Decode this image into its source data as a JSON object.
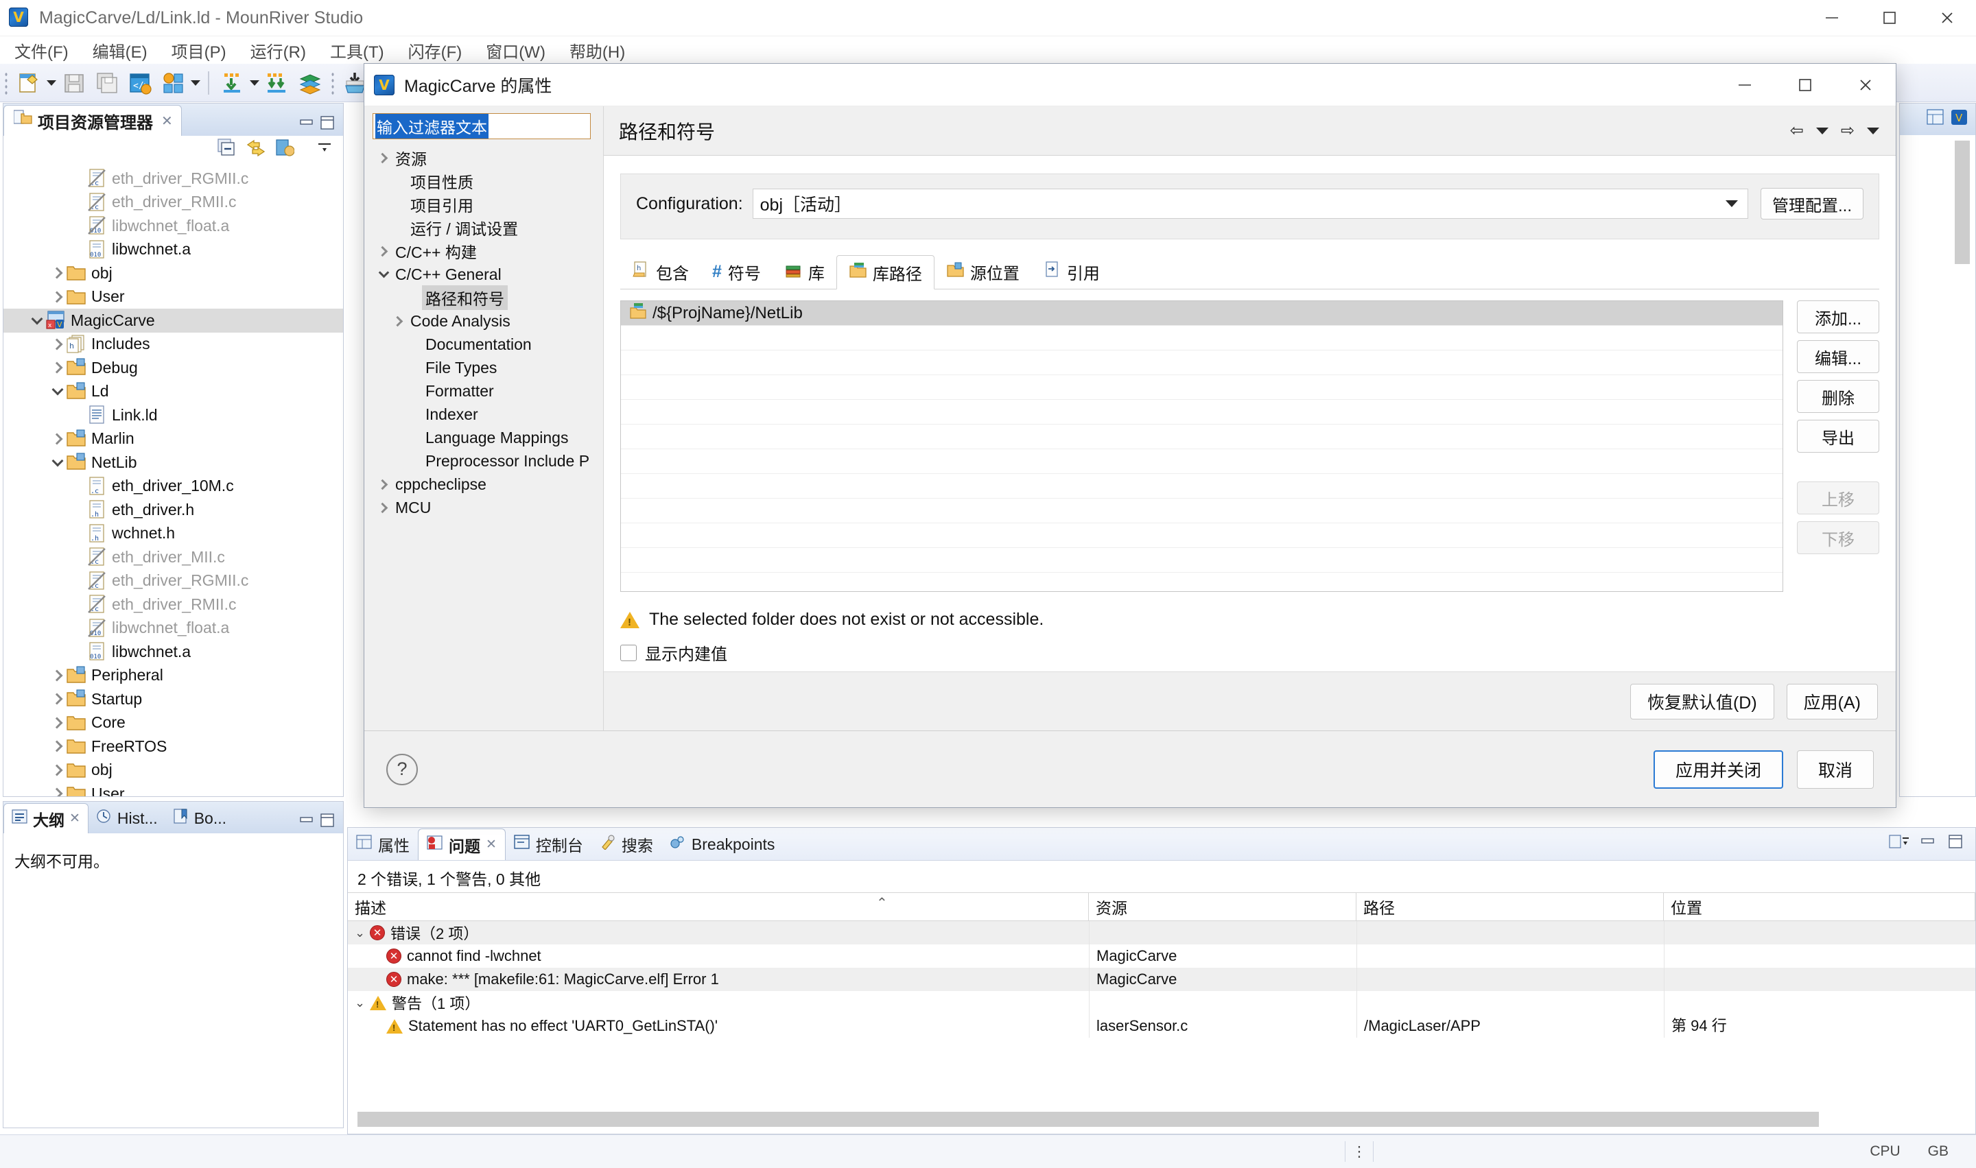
{
  "window": {
    "title": "MagicCarve/Ld/Link.ld - MounRiver Studio",
    "app_icon": "mounriver-logo-icon",
    "controls": {
      "minimize": "minimize-icon",
      "maximize": "maximize-icon",
      "close": "close-icon"
    }
  },
  "menu": {
    "items": [
      "文件(F)",
      "编辑(E)",
      "项目(P)",
      "运行(R)",
      "工具(T)",
      "闪存(F)",
      "窗口(W)",
      "帮助(H)"
    ]
  },
  "toolbar": {
    "items": [
      {
        "name": "new-icon",
        "arrow": true
      },
      {
        "name": "save-icon",
        "arrow": false
      },
      {
        "name": "save-all-icon",
        "arrow": false
      },
      {
        "name": "build-configure-icon",
        "arrow": false
      },
      {
        "name": "build-project-icon",
        "arrow": true
      },
      {
        "name": "download-icon",
        "arrow": true
      },
      {
        "name": "download-all-icon",
        "arrow": false
      },
      {
        "name": "library-icon",
        "arrow": false
      },
      {
        "name": "flash-download-icon",
        "arrow": true
      },
      {
        "name": "export-icon",
        "arrow": false
      }
    ]
  },
  "explorer": {
    "tab_label": "项目资源管理器",
    "close_icon": "close-icon",
    "tools": [
      "collapse-all-icon",
      "link-with-editor-icon",
      "view-menu-icon"
    ],
    "panel_buttons": [
      "minimize-icon",
      "maximize-icon"
    ],
    "tree": [
      {
        "label": "eth_driver_RGMII.c",
        "indent": 3,
        "twisty": "",
        "icon": "c-file-excluded-icon",
        "dim": true,
        "selected": false
      },
      {
        "label": "eth_driver_RMII.c",
        "indent": 3,
        "twisty": "",
        "icon": "c-file-excluded-icon",
        "dim": true,
        "selected": false
      },
      {
        "label": "libwchnet_float.a",
        "indent": 3,
        "twisty": "",
        "icon": "archive-excluded-icon",
        "dim": true,
        "selected": false
      },
      {
        "label": "libwchnet.a",
        "indent": 3,
        "twisty": "",
        "icon": "archive-icon",
        "dim": false,
        "selected": false
      },
      {
        "label": "obj",
        "indent": 2,
        "twisty": "right",
        "icon": "folder-icon",
        "dim": false,
        "selected": false
      },
      {
        "label": "User",
        "indent": 2,
        "twisty": "right",
        "icon": "folder-icon",
        "dim": false,
        "selected": false
      },
      {
        "label": "MagicCarve",
        "indent": 1,
        "twisty": "down",
        "icon": "project-icon",
        "dim": false,
        "selected": true
      },
      {
        "label": "Includes",
        "indent": 2,
        "twisty": "right",
        "icon": "includes-icon",
        "dim": false,
        "selected": false
      },
      {
        "label": "Debug",
        "indent": 2,
        "twisty": "right",
        "icon": "source-folder-icon",
        "dim": false,
        "selected": false
      },
      {
        "label": "Ld",
        "indent": 2,
        "twisty": "down",
        "icon": "source-folder-icon",
        "dim": false,
        "selected": false
      },
      {
        "label": "Link.ld",
        "indent": 3,
        "twisty": "",
        "icon": "text-file-icon",
        "dim": false,
        "selected": false
      },
      {
        "label": "Marlin",
        "indent": 2,
        "twisty": "right",
        "icon": "source-folder-icon",
        "dim": false,
        "selected": false
      },
      {
        "label": "NetLib",
        "indent": 2,
        "twisty": "down",
        "icon": "source-folder-icon",
        "dim": false,
        "selected": false
      },
      {
        "label": "eth_driver_10M.c",
        "indent": 3,
        "twisty": "",
        "icon": "c-file-icon",
        "dim": false,
        "selected": false
      },
      {
        "label": "eth_driver.h",
        "indent": 3,
        "twisty": "",
        "icon": "h-file-icon",
        "dim": false,
        "selected": false
      },
      {
        "label": "wchnet.h",
        "indent": 3,
        "twisty": "",
        "icon": "h-file-icon",
        "dim": false,
        "selected": false
      },
      {
        "label": "eth_driver_MII.c",
        "indent": 3,
        "twisty": "",
        "icon": "c-file-excluded-icon",
        "dim": true,
        "selected": false
      },
      {
        "label": "eth_driver_RGMII.c",
        "indent": 3,
        "twisty": "",
        "icon": "c-file-excluded-icon",
        "dim": true,
        "selected": false
      },
      {
        "label": "eth_driver_RMII.c",
        "indent": 3,
        "twisty": "",
        "icon": "c-file-excluded-icon",
        "dim": true,
        "selected": false
      },
      {
        "label": "libwchnet_float.a",
        "indent": 3,
        "twisty": "",
        "icon": "archive-excluded-icon",
        "dim": true,
        "selected": false
      },
      {
        "label": "libwchnet.a",
        "indent": 3,
        "twisty": "",
        "icon": "archive-icon",
        "dim": false,
        "selected": false
      },
      {
        "label": "Peripheral",
        "indent": 2,
        "twisty": "right",
        "icon": "source-folder-icon",
        "dim": false,
        "selected": false
      },
      {
        "label": "Startup",
        "indent": 2,
        "twisty": "right",
        "icon": "source-folder-icon",
        "dim": false,
        "selected": false
      },
      {
        "label": "Core",
        "indent": 2,
        "twisty": "right",
        "icon": "folder-icon",
        "dim": false,
        "selected": false
      },
      {
        "label": "FreeRTOS",
        "indent": 2,
        "twisty": "right",
        "icon": "folder-icon",
        "dim": false,
        "selected": false
      },
      {
        "label": "obj",
        "indent": 2,
        "twisty": "right",
        "icon": "folder-icon",
        "dim": false,
        "selected": false
      },
      {
        "label": "User",
        "indent": 2,
        "twisty": "right",
        "icon": "folder-icon",
        "dim": false,
        "selected": false
      }
    ]
  },
  "outline": {
    "tabs": [
      {
        "label": "大纲",
        "active": true,
        "icon": "outline-icon",
        "close_icon": "close-icon"
      },
      {
        "label": "Hist...",
        "active": false,
        "icon": "history-icon"
      },
      {
        "label": "Bo...",
        "active": false,
        "icon": "bookmarks-icon"
      }
    ],
    "body_text": "大纲不可用。",
    "panel_buttons": [
      "minimize-icon",
      "maximize-icon"
    ]
  },
  "dialog": {
    "title": "MagicCarve 的属性",
    "icon": "mounriver-logo-icon",
    "controls": {
      "minimize": "minimize-icon",
      "maximize": "maximize-icon",
      "close": "close-icon"
    },
    "filter": {
      "value": "输入过滤器文本",
      "placeholder": "输入过滤器文本"
    },
    "nav_tree": [
      {
        "label": "资源",
        "indent": 0,
        "twisty": "right",
        "selected": false
      },
      {
        "label": "项目性质",
        "indent": 1,
        "twisty": "",
        "selected": false
      },
      {
        "label": "项目引用",
        "indent": 1,
        "twisty": "",
        "selected": false
      },
      {
        "label": "运行 / 调试设置",
        "indent": 1,
        "twisty": "",
        "selected": false
      },
      {
        "label": "C/C++ 构建",
        "indent": 0,
        "twisty": "right",
        "selected": false
      },
      {
        "label": "C/C++ General",
        "indent": 0,
        "twisty": "down",
        "selected": false
      },
      {
        "label": "路径和符号",
        "indent": 2,
        "twisty": "",
        "selected": true
      },
      {
        "label": "Code Analysis",
        "indent": 1,
        "twisty": "right",
        "selected": false
      },
      {
        "label": "Documentation",
        "indent": 2,
        "twisty": "",
        "selected": false
      },
      {
        "label": "File Types",
        "indent": 2,
        "twisty": "",
        "selected": false
      },
      {
        "label": "Formatter",
        "indent": 2,
        "twisty": "",
        "selected": false
      },
      {
        "label": "Indexer",
        "indent": 2,
        "twisty": "",
        "selected": false
      },
      {
        "label": "Language Mappings",
        "indent": 2,
        "twisty": "",
        "selected": false
      },
      {
        "label": "Preprocessor Include P",
        "indent": 2,
        "twisty": "",
        "selected": false
      },
      {
        "label": "cppcheclipse",
        "indent": 0,
        "twisty": "right",
        "selected": false
      },
      {
        "label": "MCU",
        "indent": 0,
        "twisty": "right",
        "selected": false
      }
    ],
    "page_title": "路径和符号",
    "nav": {
      "back_icon": "back-arrow-icon",
      "back_caret": "chevron-down-icon",
      "forward_icon": "forward-arrow-icon",
      "forward_caret": "chevron-down-icon"
    },
    "configuration": {
      "label": "Configuration:",
      "value": "obj［活动］",
      "manage_button": "管理配置..."
    },
    "tabs": [
      {
        "label": "包含",
        "icon": "includes-tab-icon",
        "active": false
      },
      {
        "label": "符号",
        "icon": "symbols-tab-icon",
        "active": false
      },
      {
        "label": "库",
        "icon": "libraries-tab-icon",
        "active": false
      },
      {
        "label": "库路径",
        "icon": "library-paths-tab-icon",
        "active": true
      },
      {
        "label": "源位置",
        "icon": "source-location-tab-icon",
        "active": false
      },
      {
        "label": "引用",
        "icon": "references-tab-icon",
        "active": false
      }
    ],
    "list_items": [
      {
        "label": "/${ProjName}/NetLib",
        "icon": "library-path-icon",
        "selected": true
      }
    ],
    "list_buttons": [
      {
        "label": "添加...",
        "disabled": false
      },
      {
        "label": "编辑...",
        "disabled": false
      },
      {
        "label": "删除",
        "disabled": false
      },
      {
        "label": "导出",
        "disabled": false
      },
      {
        "label": "上移",
        "disabled": true
      },
      {
        "label": "下移",
        "disabled": true
      }
    ],
    "warning": {
      "icon": "warning-icon",
      "text": "The selected folder does not exist or not accessible."
    },
    "checkbox": {
      "label": "显示内建值",
      "checked": false
    },
    "action_buttons": [
      {
        "label": "恢复默认值(D)",
        "default": false
      },
      {
        "label": "应用(A)",
        "default": false
      }
    ],
    "footer": {
      "help_icon": "help-icon",
      "buttons": [
        {
          "label": "应用并关闭",
          "default": true
        },
        {
          "label": "取消",
          "default": false
        }
      ]
    }
  },
  "problems": {
    "tabs": [
      {
        "label": "属性",
        "icon": "properties-icon",
        "active": false
      },
      {
        "label": "问题",
        "icon": "problems-icon",
        "active": true,
        "close_icon": "close-icon"
      },
      {
        "label": "控制台",
        "icon": "console-icon",
        "active": false
      },
      {
        "label": "搜索",
        "icon": "search-icon",
        "active": false
      },
      {
        "label": "Breakpoints",
        "icon": "breakpoints-icon",
        "active": false
      }
    ],
    "tools": [
      "view-menu-icon",
      "minimize-icon",
      "maximize-icon"
    ],
    "summary": "2 个错误, 1 个警告, 0 其他",
    "columns": [
      "描述",
      "资源",
      "路径",
      "位置"
    ],
    "sort_indicator": "sort-ascending-icon",
    "rows": [
      {
        "type": "group-error",
        "icon": "error-icon",
        "twisty": "down",
        "indent": 0,
        "description": "错误（2 项）",
        "resource": "",
        "path": "",
        "location": "",
        "alt": true
      },
      {
        "type": "error",
        "icon": "error-icon",
        "twisty": "",
        "indent": 1,
        "description": "cannot find -lwchnet",
        "resource": "MagicCarve",
        "path": "",
        "location": "",
        "alt": false
      },
      {
        "type": "error",
        "icon": "error-icon",
        "twisty": "",
        "indent": 1,
        "description": "make: *** [makefile:61: MagicCarve.elf] Error 1",
        "resource": "MagicCarve",
        "path": "",
        "location": "",
        "alt": true
      },
      {
        "type": "group-warning",
        "icon": "warning-icon",
        "twisty": "down",
        "indent": 0,
        "description": "警告（1 项）",
        "resource": "",
        "path": "",
        "location": "",
        "alt": false
      },
      {
        "type": "warning",
        "icon": "warning-icon",
        "twisty": "",
        "indent": 1,
        "description": "Statement has no effect 'UART0_GetLinSTA()'",
        "resource": "laserSensor.c",
        "path": "/MagicLaser/APP",
        "location": "第 94 行",
        "alt": false
      }
    ]
  },
  "statusbar": {
    "left": "",
    "items": [
      "CPU",
      "GB"
    ]
  }
}
